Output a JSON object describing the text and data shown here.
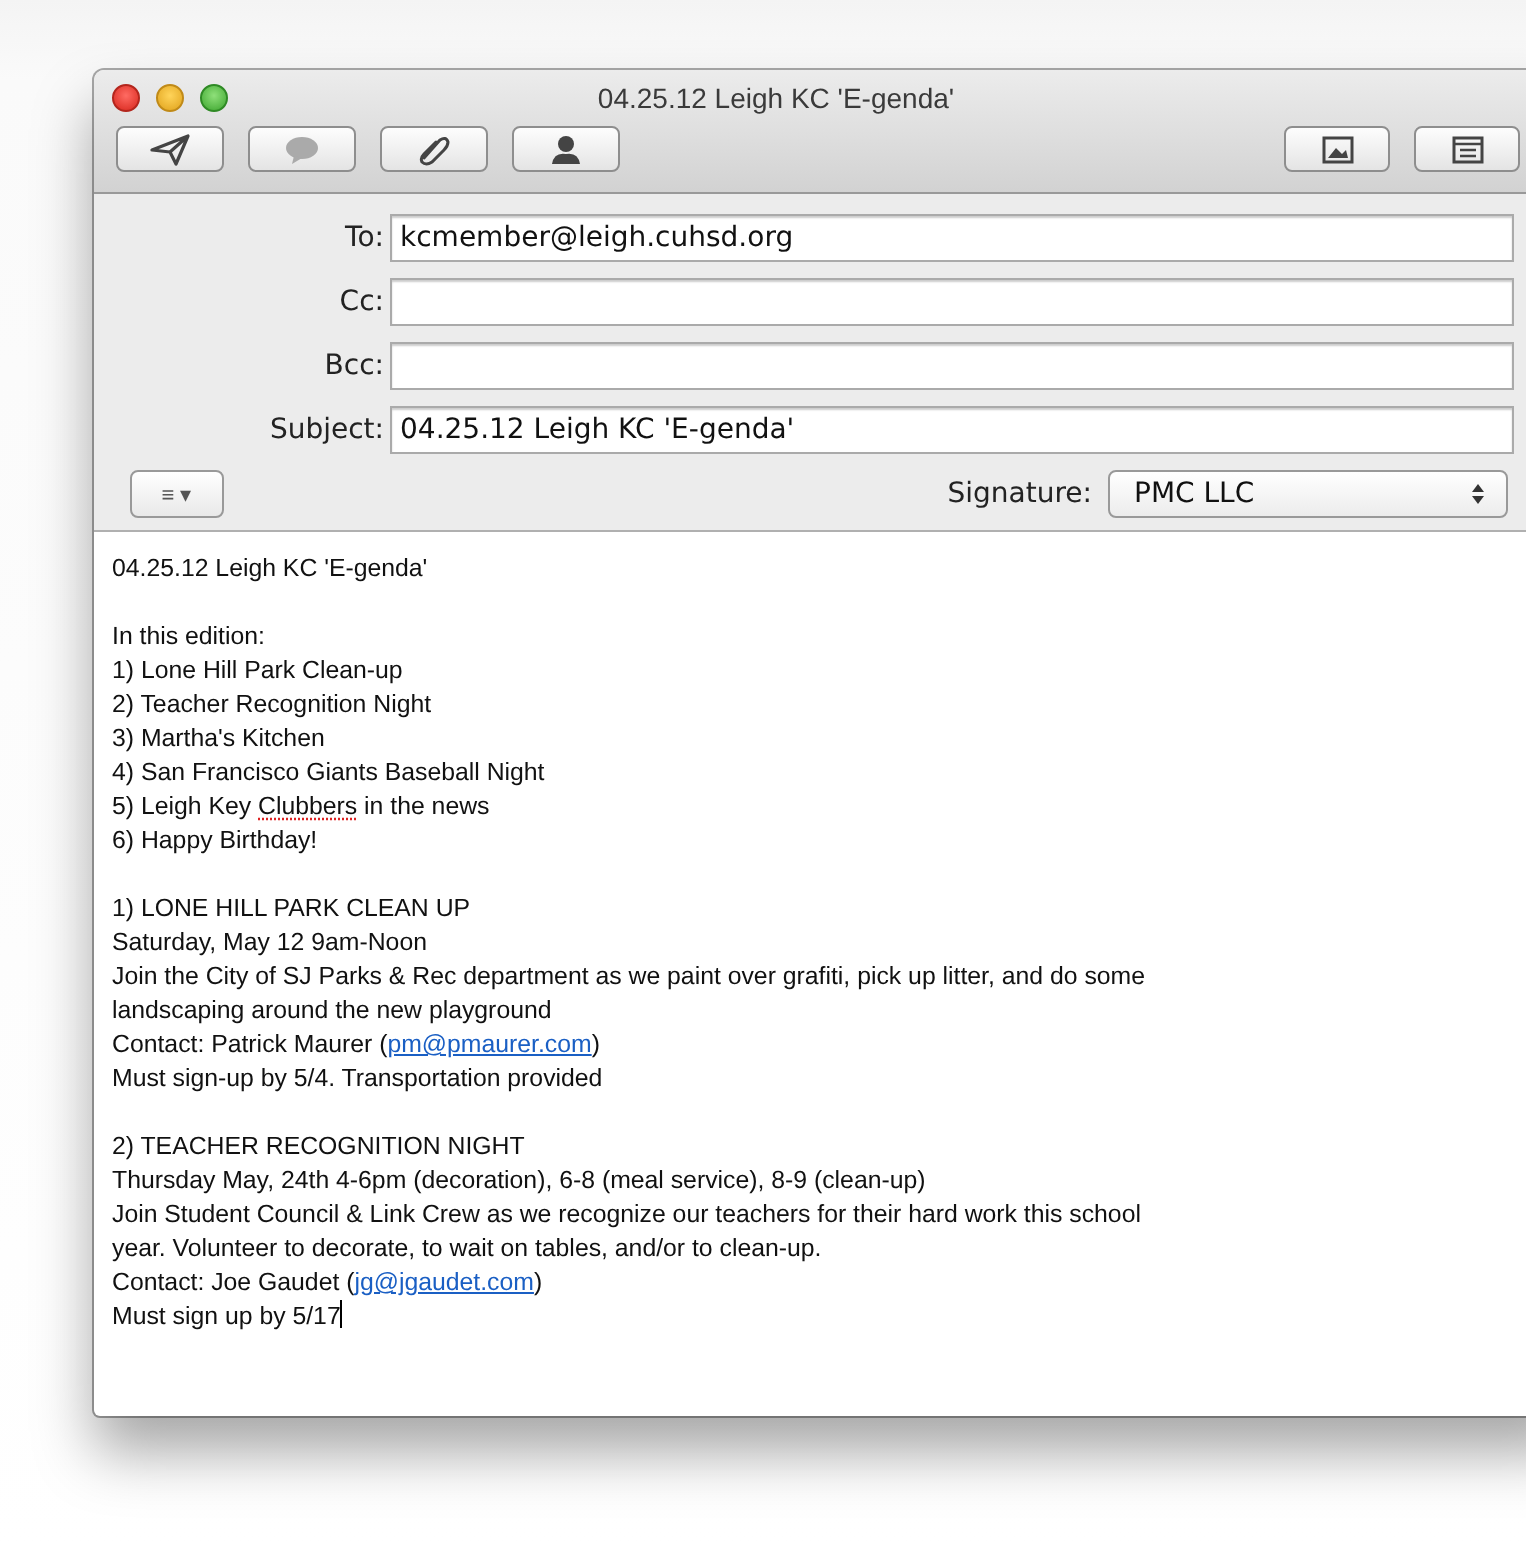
{
  "window": {
    "title": "04.25.12 Leigh KC 'E-genda'"
  },
  "toolbar": {
    "left": [
      {
        "kind": "send"
      },
      {
        "kind": "reply"
      },
      {
        "kind": "attach"
      },
      {
        "kind": "contact"
      }
    ],
    "right": [
      {
        "kind": "photo"
      },
      {
        "kind": "template"
      }
    ]
  },
  "fields": [
    {
      "label": "To:",
      "value": "kcmember@leigh.cuhsd.org"
    },
    {
      "label": "Cc:"
    },
    {
      "label": "Bcc:"
    },
    {
      "label": "Subject:",
      "value": "04.25.12 Leigh KC 'E-genda'"
    }
  ],
  "format_menu": {
    "icon": "≡ ▾"
  },
  "signature": {
    "label": "Signature:",
    "value": "PMC LLC"
  },
  "body": {
    "paragraphs": [
      [
        [
          {
            "text": "04.25.12 Leigh KC 'E-genda'"
          }
        ]
      ],
      [
        [
          {
            "text": "In this edition:"
          }
        ],
        [
          {
            "text": "1) Lone Hill Park Clean-up"
          }
        ],
        [
          {
            "text": "2) Teacher Recognition Night"
          }
        ],
        [
          {
            "text": "3) Martha's Kitchen"
          }
        ],
        [
          {
            "text": "4) San Francisco Giants Baseball Night"
          }
        ],
        [
          {
            "text": "5) Leigh Key "
          },
          {
            "text": "Clubbers",
            "kind": "misspelled"
          },
          {
            "text": " in the news"
          }
        ],
        [
          {
            "text": "6) Happy Birthday!"
          }
        ]
      ],
      [
        [
          {
            "text": "1) LONE HILL PARK CLEAN UP"
          }
        ],
        [
          {
            "text": "Saturday, May 12 9am-Noon"
          }
        ],
        [
          {
            "text": "Join the City of SJ Parks & Rec department as we paint over grafiti, pick up litter, and do some"
          }
        ],
        [
          {
            "text": "landscaping around the new playground"
          }
        ],
        [
          {
            "text": "Contact: Patrick Maurer ("
          },
          {
            "text": "pm@pmaurer.com",
            "kind": "link"
          },
          {
            "text": ")"
          }
        ],
        [
          {
            "text": "Must sign-up by 5/4. Transportation provided"
          }
        ]
      ],
      [
        [
          {
            "text": "2) TEACHER RECOGNITION NIGHT"
          }
        ],
        [
          {
            "text": "Thursday May, 24th 4-6pm (decoration), 6-8 (meal service), 8-9 (clean-up)"
          }
        ],
        [
          {
            "text": "Join Student Council & Link Crew as we recognize our teachers for their hard work this school"
          }
        ],
        [
          {
            "text": "year. Volunteer to decorate, to wait on tables, and/or to clean-up."
          }
        ],
        [
          {
            "text": "Contact: Joe Gaudet ("
          },
          {
            "text": "jg@jgaudet.com",
            "kind": "link"
          },
          {
            "text": ")"
          }
        ],
        [
          {
            "text": "Must sign up by 5/17"
          },
          {
            "kind": "cursor"
          }
        ]
      ]
    ]
  }
}
